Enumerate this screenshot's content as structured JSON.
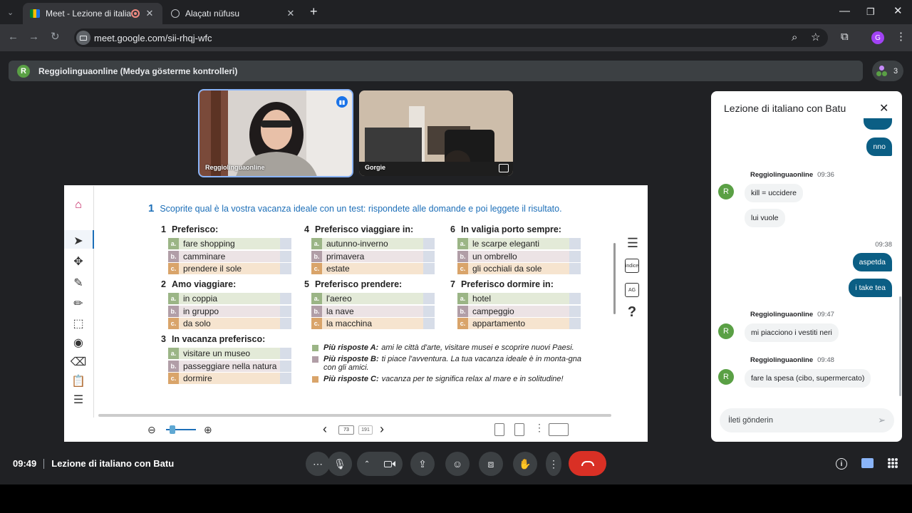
{
  "browser": {
    "tabs": [
      {
        "title": "Meet - Lezione di italiano c",
        "active": true
      },
      {
        "title": "Alaçatı nüfusu",
        "active": false
      }
    ],
    "url": "meet.google.com/sii-rhqj-wfc",
    "profile_initial": "G"
  },
  "presentation_bar": {
    "avatar_initial": "R",
    "title": "Reggiolinguaonline (Medya gösterme kontrolleri)",
    "participant_count": "3"
  },
  "participants": [
    {
      "name": "Reggiolinguaonline"
    },
    {
      "name": "Gorgie"
    }
  ],
  "document": {
    "exercise_number": "1",
    "instruction": "Scoprite qual è la vostra vacanza ideale con un test: rispondete alle domande e poi leggete il risultato.",
    "questions": [
      {
        "num": "1",
        "title": "Preferisco:",
        "options": [
          [
            "a.",
            "fare shopping"
          ],
          [
            "b.",
            "camminare"
          ],
          [
            "c.",
            "prendere il sole"
          ]
        ]
      },
      {
        "num": "2",
        "title": "Amo viaggiare:",
        "options": [
          [
            "a.",
            "in coppia"
          ],
          [
            "b.",
            "in gruppo"
          ],
          [
            "c.",
            "da solo"
          ]
        ]
      },
      {
        "num": "3",
        "title": "In vacanza preferisco:",
        "options": [
          [
            "a.",
            "visitare un museo"
          ],
          [
            "b.",
            "passeggiare nella natura"
          ],
          [
            "c.",
            "dormire"
          ]
        ]
      },
      {
        "num": "4",
        "title": "Preferisco viaggiare in:",
        "options": [
          [
            "a.",
            "autunno-inverno"
          ],
          [
            "b.",
            "primavera"
          ],
          [
            "c.",
            "estate"
          ]
        ]
      },
      {
        "num": "5",
        "title": "Preferisco prendere:",
        "options": [
          [
            "a.",
            "l'aereo"
          ],
          [
            "b.",
            "la nave"
          ],
          [
            "c.",
            "la macchina"
          ]
        ]
      },
      {
        "num": "6",
        "title": "In valigia porto sempre:",
        "options": [
          [
            "a.",
            "le scarpe eleganti"
          ],
          [
            "b.",
            "un ombrello"
          ],
          [
            "c.",
            "gli occhiali da sole"
          ]
        ]
      },
      {
        "num": "7",
        "title": "Preferisco dormire in:",
        "options": [
          [
            "a.",
            "hotel"
          ],
          [
            "b.",
            "campeggio"
          ],
          [
            "c.",
            "appartamento"
          ]
        ]
      }
    ],
    "results": [
      {
        "label": "Più risposte A:",
        "text": "ami le città d'arte, visitare musei e scoprire nuovi Paesi.",
        "color": "#9bb586"
      },
      {
        "label": "Più risposte B:",
        "text": "ti piace l'avventura. La tua vacanza ideale è in monta-gna con gli amici.",
        "color": "#b19ea7"
      },
      {
        "label": "Più risposte C:",
        "text": "vacanza per te significa relax al mare e in solitudine!",
        "color": "#d9a46a"
      }
    ],
    "right_tools": {
      "index_label": "indice",
      "ag_label": "AG"
    },
    "page_current": "73",
    "page_total": "191"
  },
  "chat": {
    "title": "Lezione di italiano con Batu",
    "messages": [
      {
        "from": "me",
        "text": "nno"
      },
      {
        "from": "them",
        "sender": "Reggiolinguaonline",
        "time": "09:36",
        "texts": [
          "kill = uccidere",
          "lui vuole"
        ]
      },
      {
        "from": "me",
        "time": "09:38",
        "texts": [
          "aspetda",
          "i take tea"
        ]
      },
      {
        "from": "them",
        "sender": "Reggiolinguaonline",
        "time": "09:47",
        "texts": [
          "mi piacciono i vestiti neri"
        ]
      },
      {
        "from": "them",
        "sender": "Reggiolinguaonline",
        "time": "09:48",
        "texts": [
          "fare la spesa (cibo, supermercato)"
        ]
      }
    ],
    "input_placeholder": "İleti gönderin"
  },
  "bottom_bar": {
    "time": "09:49",
    "meeting_title": "Lezione di italiano con Batu"
  },
  "colors": {
    "end_call": "#d93025",
    "chat_bubble": "#0b5e84",
    "doc_title_blue": "#1d6fb8"
  }
}
